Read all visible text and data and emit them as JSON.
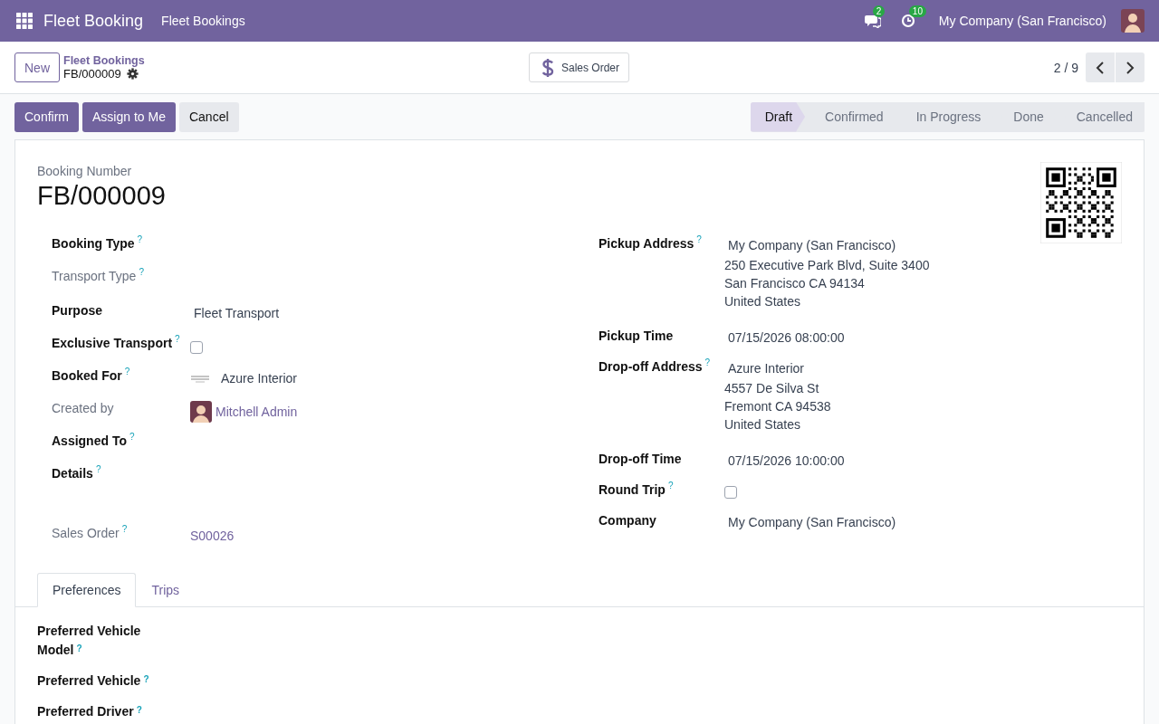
{
  "navbar": {
    "app_title": "Fleet Booking",
    "menu": [
      "Fleet Bookings"
    ],
    "messages_count": "2",
    "activities_count": "10",
    "company": "My Company (San Francisco)"
  },
  "control_panel": {
    "new_button": "New",
    "breadcrumb": "Fleet Bookings",
    "record": "FB/000009",
    "smart_button": "Sales Order",
    "pager": "2 / 9"
  },
  "actions": [
    {
      "label": "Confirm",
      "kind": "primary"
    },
    {
      "label": "Assign to Me",
      "kind": "primary"
    },
    {
      "label": "Cancel",
      "kind": "secondary"
    }
  ],
  "statusbar": [
    {
      "label": "Draft",
      "selected": true
    },
    {
      "label": "Confirmed",
      "selected": false
    },
    {
      "label": "In Progress",
      "selected": false
    },
    {
      "label": "Done",
      "selected": false
    },
    {
      "label": "Cancelled",
      "selected": false
    }
  ],
  "form": {
    "title_label": "Booking Number",
    "title": "FB/000009",
    "left_fields": [
      {
        "label": "Booking Type",
        "help": "?",
        "readonly": false,
        "kind": "empty"
      },
      {
        "label": "Transport Type",
        "help": "?",
        "readonly": true,
        "kind": "empty"
      },
      {
        "label": "Purpose",
        "readonly": false,
        "kind": "text",
        "value": "Fleet Transport"
      },
      {
        "label": "Exclusive Transport",
        "help": "?",
        "readonly": false,
        "kind": "checkbox",
        "checked": false
      },
      {
        "label": "Booked For",
        "help": "?",
        "readonly": false,
        "kind": "partner",
        "value": "Azure Interior"
      },
      {
        "label": "Created by",
        "readonly": true,
        "kind": "user",
        "value": "Mitchell Admin"
      },
      {
        "label": "Assigned To",
        "help": "?",
        "readonly": false,
        "kind": "empty"
      },
      {
        "label": "Details",
        "help": "?",
        "readonly": false,
        "kind": "html"
      },
      {
        "label": "Sales Order",
        "help": "?",
        "readonly": true,
        "kind": "link",
        "value": "S00026"
      }
    ],
    "right_fields": [
      {
        "label": "Pickup Address",
        "help": "?",
        "readonly": false,
        "kind": "address",
        "value": "My Company (San Francisco)",
        "lines": [
          "250 Executive Park Blvd, Suite 3400",
          "San Francisco CA 94134",
          "United States"
        ]
      },
      {
        "label": "Pickup Time",
        "readonly": false,
        "kind": "text",
        "value": "07/15/2026 08:00:00"
      },
      {
        "label": "Drop-off Address",
        "help": "?",
        "readonly": false,
        "kind": "address",
        "value": "Azure Interior",
        "lines": [
          "4557 De Silva St",
          "Fremont CA 94538",
          "United States"
        ]
      },
      {
        "label": "Drop-off Time",
        "readonly": false,
        "kind": "text",
        "value": "07/15/2026 10:00:00"
      },
      {
        "label": "Round Trip",
        "help": "?",
        "readonly": false,
        "kind": "checkbox",
        "checked": false
      },
      {
        "label": "Company",
        "readonly": false,
        "kind": "text",
        "value": "My Company (San Francisco)"
      }
    ]
  },
  "tabs": [
    {
      "label": "Preferences",
      "selected": true
    },
    {
      "label": "Trips",
      "selected": false
    }
  ],
  "tab_fields": [
    {
      "label": "Preferred Vehicle Model",
      "help": "?"
    },
    {
      "label": "Preferred Vehicle",
      "help": "?"
    },
    {
      "label": "Preferred Driver",
      "help": "?"
    }
  ]
}
